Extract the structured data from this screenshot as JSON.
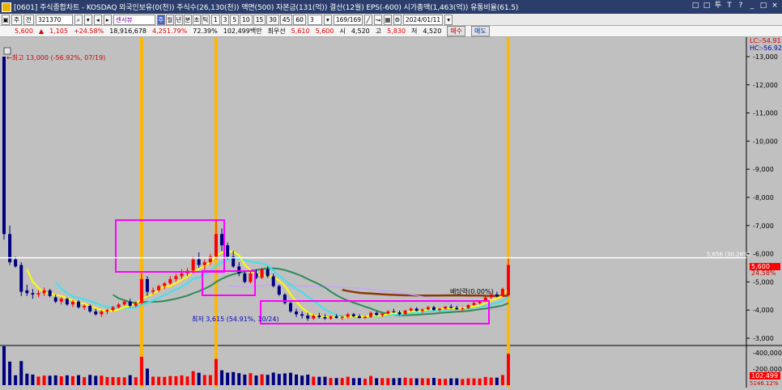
{
  "window": {
    "title": "[0601] 주식종합차트 - KOSDAQ 외국인보유(0(천)) 주식수(26,130(천)) 액면(500) 자본금(131(억)) 결산(12월) EPS(-600) 시가총액(1,463(억)) 유통비율(61.5)",
    "buttons": [
      "□",
      "□",
      "투",
      "T",
      "?",
      "_",
      "□",
      "×"
    ]
  },
  "toolbar": {
    "market": "주",
    "market2": "전",
    "code": "321370",
    "name": "센서뷰",
    "periods": [
      "주",
      "월",
      "년",
      "분",
      "초",
      "틱"
    ],
    "intervals": [
      "1",
      "3",
      "5",
      "10",
      "15",
      "30",
      "45",
      "60"
    ],
    "interval_value": "3",
    "count": "169/169",
    "date": "2024/01/11"
  },
  "infobar": {
    "price": "5,600",
    "arrow": "▲",
    "change": "1,105",
    "change_pct": "+24.58%",
    "volume": "18,916,678",
    "volume_pct": "4,251.79%",
    "turnover": "72.39%",
    "amount": "102,499백만",
    "weighted_label": "최우선",
    "best_ask": "5,610",
    "best_bid": "5,600",
    "open_label": "시",
    "open": "4,520",
    "high_label": "고",
    "high": "5,830",
    "low_label": "저",
    "low": "4,520",
    "buy_label": "매수",
    "sell_label": "매도"
  },
  "annotations": {
    "high": "최고 13,000 (-56.92%, 07/19)",
    "low": "최저 3,615 (54.91%, 10/24)",
    "dividend": "배당락(0.00%)",
    "line_label": "5,856 (30.28%)",
    "lc": "LC:-54.91",
    "hc": "HC:-56.92",
    "price_tag": "5,600",
    "price_pct": "24.58%",
    "vol_tag": "102,499",
    "vol_pct": "5146.12%"
  },
  "colors": {
    "up": "#ff0000",
    "down": "#000080",
    "highlight": "#ffb800",
    "box": "#ff00ff",
    "ma_brown": "#8b3a0a",
    "ma_green": "#2e8b57",
    "ma_yellow": "#ffff00",
    "ma_cyan": "#40e0f0",
    "ma_violet": "#c8a0ff"
  },
  "chart_data": {
    "type": "candlestick",
    "y_axis": {
      "range": [
        3000,
        13500
      ],
      "ticks": [
        3000,
        4000,
        5000,
        6000,
        7000,
        8000,
        9000,
        10000,
        11000,
        12000,
        13000
      ],
      "tick_labels": [
        "3,000",
        "4,000",
        "5,000",
        "6,000",
        "7,000",
        "8,000",
        "9,000",
        "10,000",
        "11,000",
        "12,000",
        "13,000"
      ]
    },
    "volume_axis": {
      "ticks": [
        200000,
        400000
      ],
      "tick_labels": [
        "200,000",
        "400,000"
      ]
    },
    "reference_line": 5856,
    "candles": [
      [
        13000,
        13000,
        6500,
        6700
      ],
      [
        6700,
        7000,
        5600,
        5700
      ],
      [
        5800,
        5900,
        5500,
        5550
      ],
      [
        5600,
        5700,
        4500,
        4650
      ],
      [
        4700,
        4900,
        4500,
        4600
      ],
      [
        4600,
        4750,
        4400,
        4550
      ],
      [
        4550,
        4700,
        4450,
        4600
      ],
      [
        4600,
        4800,
        4500,
        4700
      ],
      [
        4700,
        4750,
        4450,
        4500
      ],
      [
        4450,
        4550,
        4250,
        4300
      ],
      [
        4300,
        4450,
        4200,
        4400
      ],
      [
        4400,
        4450,
        4150,
        4200
      ],
      [
        4200,
        4350,
        4100,
        4300
      ],
      [
        4300,
        4350,
        4050,
        4100
      ],
      [
        4100,
        4200,
        4000,
        4150
      ],
      [
        4150,
        4200,
        3900,
        3950
      ],
      [
        3950,
        4050,
        3800,
        3850
      ],
      [
        3850,
        4000,
        3750,
        3950
      ],
      [
        3950,
        4050,
        3850,
        4000
      ],
      [
        4000,
        4150,
        3950,
        4100
      ],
      [
        4100,
        4250,
        4050,
        4200
      ],
      [
        4200,
        4350,
        4150,
        4300
      ],
      [
        4300,
        4400,
        4100,
        4150
      ],
      [
        4150,
        4300,
        4100,
        4250
      ],
      [
        4250,
        5300,
        4200,
        5100
      ],
      [
        5100,
        5200,
        4500,
        4650
      ],
      [
        4650,
        4800,
        4550,
        4700
      ],
      [
        4700,
        4900,
        4650,
        4850
      ],
      [
        4850,
        5000,
        4750,
        4950
      ],
      [
        4950,
        5200,
        4900,
        5100
      ],
      [
        5100,
        5300,
        5000,
        5200
      ],
      [
        5200,
        5450,
        5100,
        5300
      ],
      [
        5300,
        5500,
        5200,
        5400
      ],
      [
        5400,
        5900,
        5300,
        5800
      ],
      [
        5800,
        6050,
        5500,
        5600
      ],
      [
        5600,
        5800,
        5400,
        5700
      ],
      [
        5700,
        6000,
        5600,
        5900
      ],
      [
        5900,
        7200,
        5800,
        6700
      ],
      [
        6700,
        6900,
        6100,
        6300
      ],
      [
        6300,
        6400,
        5800,
        5900
      ],
      [
        5900,
        6100,
        5500,
        5550
      ],
      [
        5550,
        5700,
        5200,
        5300
      ],
      [
        5300,
        5350,
        4950,
        5000
      ],
      [
        5000,
        5400,
        4950,
        5300
      ],
      [
        5300,
        5450,
        5100,
        5150
      ],
      [
        5150,
        5500,
        5100,
        5450
      ],
      [
        5450,
        5550,
        5150,
        5200
      ],
      [
        5200,
        5300,
        4800,
        4850
      ],
      [
        4850,
        4900,
        4500,
        4550
      ],
      [
        4550,
        4600,
        4200,
        4250
      ],
      [
        4250,
        4300,
        3900,
        3950
      ],
      [
        3950,
        4050,
        3750,
        3850
      ],
      [
        3850,
        3950,
        3700,
        3800
      ],
      [
        3800,
        3900,
        3615,
        3700
      ],
      [
        3700,
        3850,
        3650,
        3800
      ],
      [
        3800,
        3900,
        3700,
        3750
      ],
      [
        3750,
        3850,
        3650,
        3700
      ],
      [
        3700,
        3800,
        3650,
        3780
      ],
      [
        3780,
        3850,
        3700,
        3720
      ],
      [
        3720,
        3800,
        3650,
        3760
      ],
      [
        3760,
        3900,
        3700,
        3850
      ],
      [
        3850,
        3900,
        3750,
        3780
      ],
      [
        3780,
        3850,
        3700,
        3720
      ],
      [
        3720,
        3800,
        3680,
        3760
      ],
      [
        3760,
        3950,
        3720,
        3900
      ],
      [
        3900,
        3950,
        3800,
        3820
      ],
      [
        3820,
        3900,
        3750,
        3870
      ],
      [
        3870,
        4000,
        3850,
        3950
      ],
      [
        3950,
        4050,
        3900,
        3920
      ],
      [
        3920,
        3980,
        3820,
        3850
      ],
      [
        3850,
        4000,
        3830,
        3980
      ],
      [
        3980,
        4100,
        3950,
        4050
      ],
      [
        4050,
        4100,
        3950,
        3970
      ],
      [
        3970,
        4050,
        3900,
        4020
      ],
      [
        4020,
        4150,
        4000,
        4100
      ],
      [
        4100,
        4150,
        3980,
        4000
      ],
      [
        4000,
        4080,
        3950,
        4050
      ],
      [
        4050,
        4150,
        4020,
        4120
      ],
      [
        4120,
        4200,
        4050,
        4080
      ],
      [
        4080,
        4150,
        4000,
        4030
      ],
      [
        4030,
        4100,
        3980,
        4060
      ],
      [
        4060,
        4200,
        4050,
        4180
      ],
      [
        4180,
        4300,
        4150,
        4250
      ],
      [
        4250,
        4350,
        4200,
        4300
      ],
      [
        4300,
        4500,
        4280,
        4450
      ],
      [
        4450,
        4600,
        4400,
        4550
      ],
      [
        4550,
        4650,
        4450,
        4500
      ],
      [
        4500,
        4800,
        4480,
        4750
      ],
      [
        4520,
        5830,
        4520,
        5600
      ]
    ]
  }
}
